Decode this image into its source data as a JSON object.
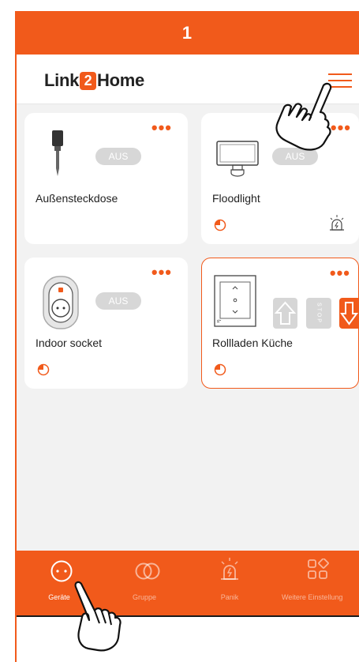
{
  "step_number": "1",
  "app": {
    "logo_prefix": "Link",
    "logo_two": "2",
    "logo_suffix": "Home"
  },
  "devices": [
    {
      "name": "Außensteckdose",
      "status": "AUS"
    },
    {
      "name": "Floodlight",
      "status": "AUS"
    },
    {
      "name": "Indoor socket",
      "status": "AUS"
    },
    {
      "name": "Rollladen Küche",
      "stop_label": "STOP"
    }
  ],
  "nav": [
    {
      "label": "Geräte"
    },
    {
      "label": "Gruppe"
    },
    {
      "label": "Panik"
    },
    {
      "label": "Weitere Einstellung"
    }
  ],
  "colors": {
    "accent": "#f15a1b",
    "pill": "#d7d7d7"
  }
}
